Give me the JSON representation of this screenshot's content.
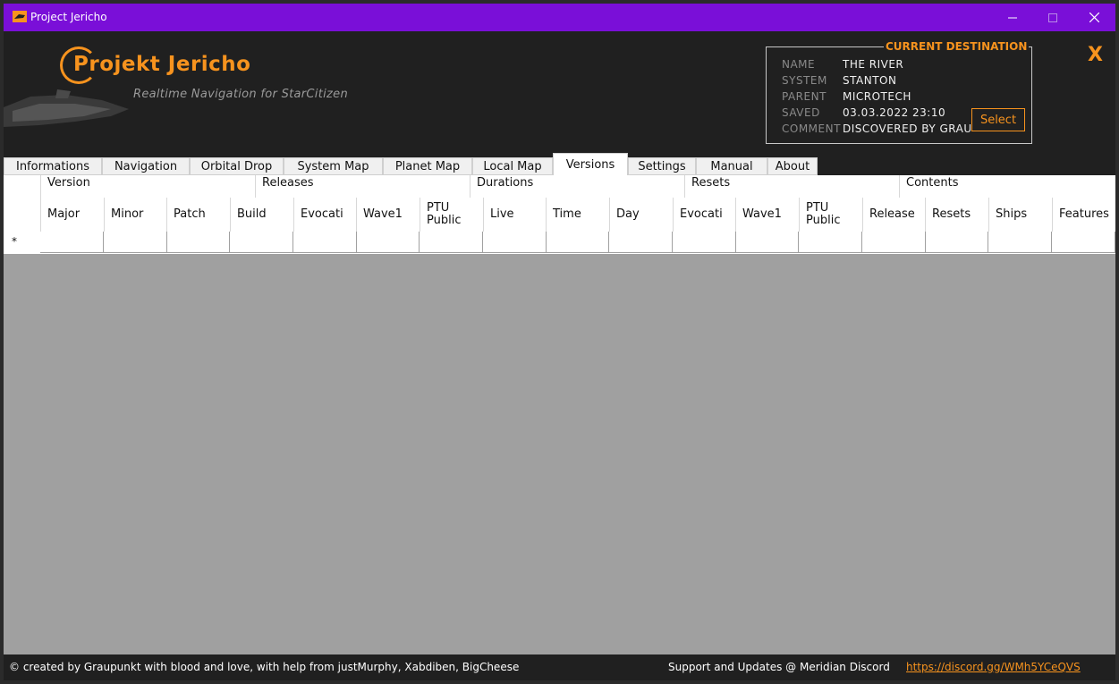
{
  "window": {
    "title": "Project Jericho"
  },
  "header": {
    "logo_title": "Projekt Jericho",
    "logo_subtitle": "Realtime Navigation for StarCitizen"
  },
  "destination": {
    "legend": "CURRENT DESTINATION",
    "rows": [
      {
        "key": "NAME",
        "value": "THE RIVER"
      },
      {
        "key": "SYSTEM",
        "value": "STANTON"
      },
      {
        "key": "PARENT",
        "value": "MICROTECH"
      },
      {
        "key": "SAVED",
        "value": "03.03.2022 23:10"
      },
      {
        "key": "COMMENT",
        "value": "DISCOVERED BY GRAUPUNKT"
      }
    ],
    "select_label": "Select",
    "close_label": "X"
  },
  "tabs": [
    {
      "label": "Informations",
      "active": false
    },
    {
      "label": "Navigation",
      "active": false
    },
    {
      "label": "Orbital Drop",
      "active": false
    },
    {
      "label": "System Map",
      "active": false
    },
    {
      "label": "Planet Map",
      "active": false
    },
    {
      "label": "Local Map",
      "active": false
    },
    {
      "label": "Versions",
      "active": true
    },
    {
      "label": "Settings",
      "active": false
    },
    {
      "label": "Manual",
      "active": false
    },
    {
      "label": "About",
      "active": false
    }
  ],
  "grid": {
    "bands": [
      "Version",
      "Releases",
      "Durations",
      "Resets",
      "Contents"
    ],
    "columns": [
      "Major",
      "Minor",
      "Patch",
      "Build",
      "Evocati",
      "Wave1",
      "PTU\nPublic",
      "Live",
      "Time",
      "Day",
      "Evocati",
      "Wave1",
      "PTU\nPublic",
      "Release",
      "Resets",
      "Ships",
      "Features"
    ],
    "new_row_marker": "*"
  },
  "footer": {
    "credits": "© created by Graupunkt with blood and love, with help from justMurphy, Xabdiben, BigCheese",
    "support": "Support and Updates @ Meridian Discord",
    "link": "https://discord.gg/WMh5YCeQVS"
  },
  "colors": {
    "titlebar": "#7a0fd8",
    "accent": "#f7931e",
    "background": "#202020",
    "grid_empty": "#a0a0a0"
  }
}
